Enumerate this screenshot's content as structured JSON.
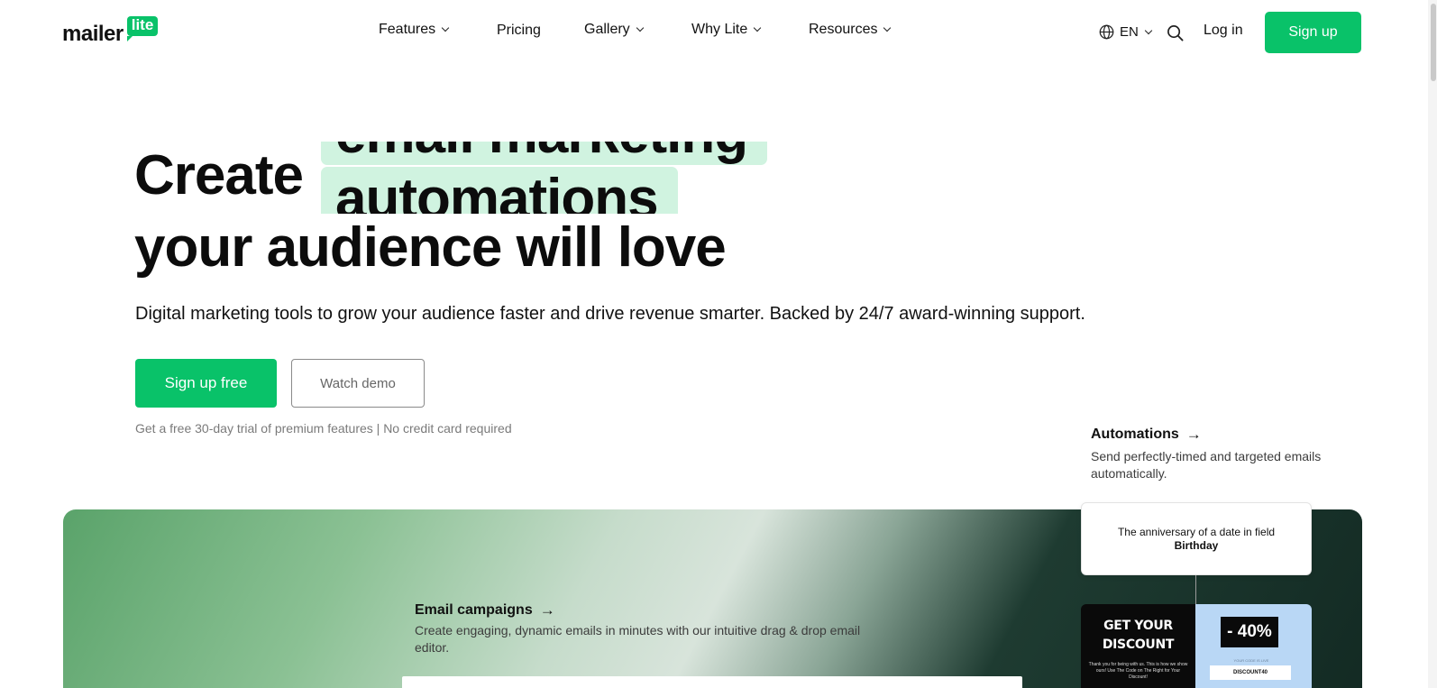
{
  "brand": {
    "word": "mailer",
    "badge": "lite",
    "accent": "#09c269"
  },
  "nav": {
    "items": [
      {
        "label": "Features",
        "dropdown": true
      },
      {
        "label": "Pricing",
        "dropdown": false
      },
      {
        "label": "Gallery",
        "dropdown": true
      },
      {
        "label": "Why Lite",
        "dropdown": true
      },
      {
        "label": "Resources",
        "dropdown": true
      }
    ],
    "language": "EN",
    "login": "Log in",
    "signup": "Sign up"
  },
  "hero": {
    "create": "Create",
    "rotating_prev": "email marketing",
    "rotating_current": "automations",
    "line2": "your audience will love",
    "subtitle": "Digital marketing tools to grow your audience faster and drive revenue smarter. Backed by 24/7 award-winning support.",
    "cta_primary": "Sign up free",
    "cta_secondary": "Watch demo",
    "note": "Get a free 30-day trial of premium features | No credit card required"
  },
  "features": {
    "email_campaigns": {
      "title": "Email campaigns",
      "arrow": "→",
      "desc": "Create engaging, dynamic emails in minutes with our intuitive drag & drop email editor."
    },
    "automations": {
      "title": "Automations",
      "arrow": "→",
      "desc": "Send perfectly-timed and targeted emails automatically."
    }
  },
  "trigger": {
    "text": "The anniversary of a date in field",
    "field": "Birthday"
  },
  "promo": {
    "head_line1": "GET YOUR",
    "head_line2": "DISCOUNT",
    "small": "Thank you for being with us. This is how we show ours! Use The Code on The Right for Your Discount!",
    "percent": "- 40%",
    "mini": "YOUR CODE IS LIVE",
    "code": "DISCOUNT40"
  }
}
